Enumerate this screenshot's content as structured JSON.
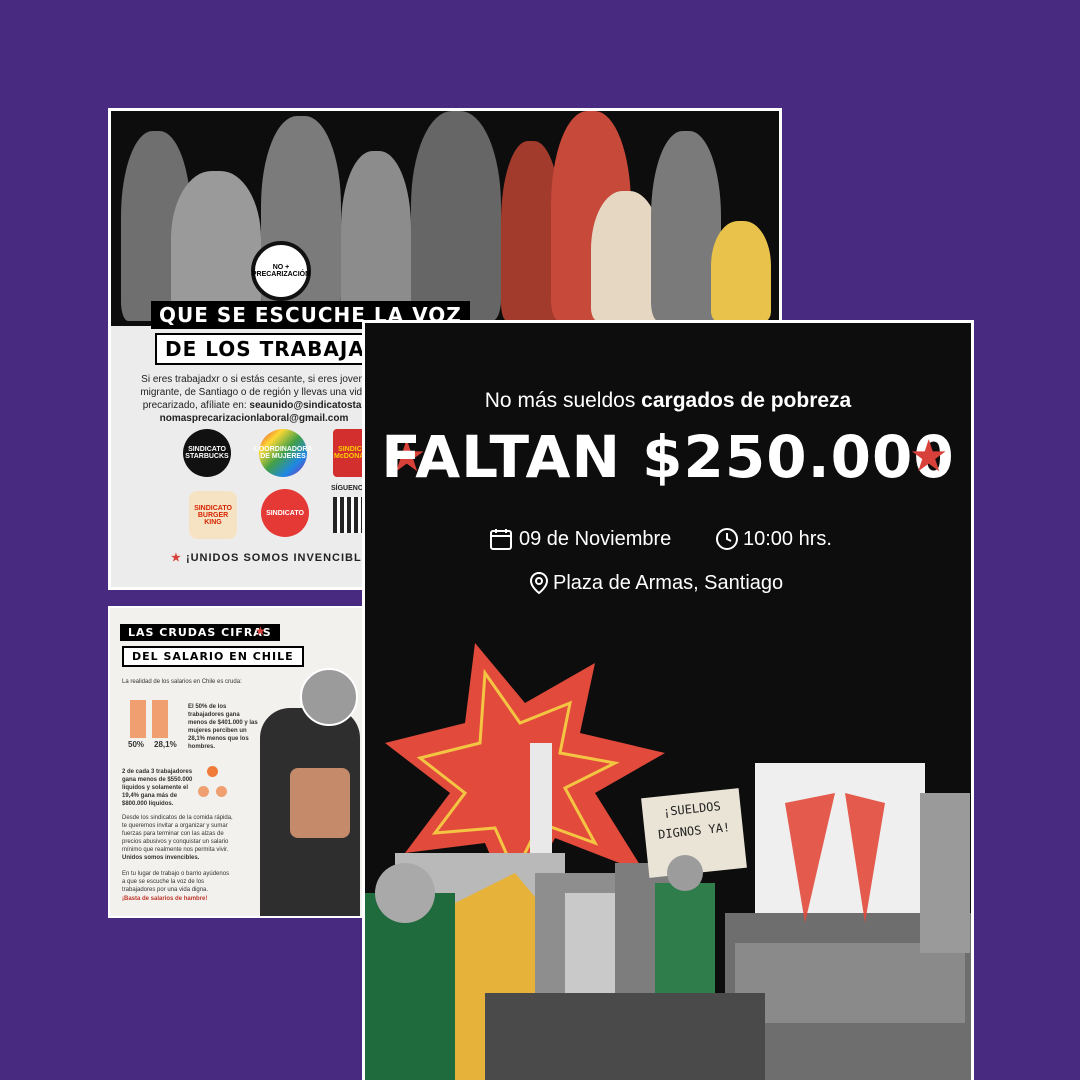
{
  "card1": {
    "headline_line1": "QUE SE ESCUCHE LA VOZ",
    "headline_line2": "DE LOS TRABAJADOR",
    "body_line1": "Si eres trabajadxr o si estás cesante, si eres joven,",
    "body_line2": "migrante, de Santiago o de región y llevas una vida",
    "body_line3_prefix": "precarizado, afíliate en: ",
    "body_email1": "seaunido@sindicatostar",
    "body_email2": "nomasprecarizacionlaboral@gmail.com",
    "badge_text": "NO + PRECARIZACIÓN",
    "logos": [
      "SINDICATO STARBUCKS",
      "COORDINADORA DE MUJERES",
      "SINDICATO McDONALD'S",
      "SINDICATO BURGER KING",
      "SINDICATO"
    ],
    "follow_label": "SÍGUENOS E",
    "footer": "¡UNIDOS SOMOS INVENCIBLES"
  },
  "card2": {
    "title_line1": "LAS CRUDAS CIFRAS",
    "title_line2": "DEL SALARIO EN CHILE",
    "intro": "La realidad de los salarios en Chile es cruda:",
    "stat1_text": "El 50% de los trabajadores gana menos de $401.000 y las mujeres perciben un 28,1% menos que los hombres.",
    "bar_labels": [
      "50%",
      "28,1%"
    ],
    "stat2_text": "2 de cada 3 trabajadores gana menos de $550.000 líquidos y solamente el 19,4% gana más de $800.000 líquidos.",
    "para1": "Desde los sindicatos de la comida rápida, te queremos invitar a organizar y sumar fuerzas para terminar con las alzas de precios abusivos y conquistar un salario mínimo que realmente nos permita vivir.",
    "para1_bold": "Unidos somos invencibles.",
    "para2": "En tu lugar de trabajo o barrio ayúdenos a que se escuche la voz de los trabajadores por una vida digna.",
    "closing": "¡Basta de salarios de hambre!"
  },
  "poster": {
    "subtitle_regular": "No más sueldos ",
    "subtitle_bold": "cargados de pobreza",
    "headline": "FALTAN $250.000",
    "date": "09 de Noviembre",
    "time": "10:00 hrs.",
    "place": "Plaza de Armas, Santiago",
    "sign_text": "¡SUELDOS DIGNOS YA!",
    "accent_color": "#d8403a"
  }
}
